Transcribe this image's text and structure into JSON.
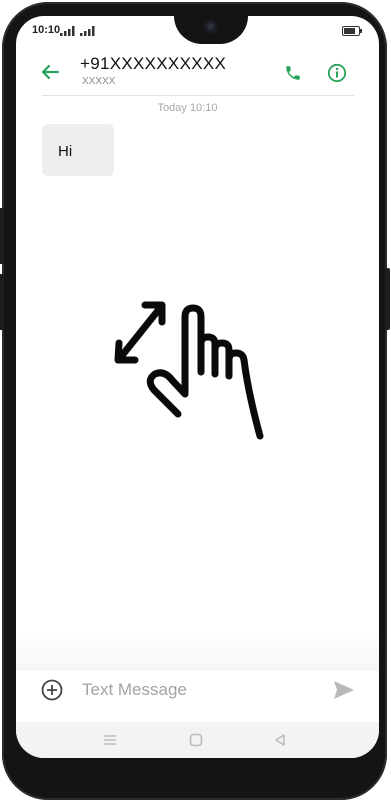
{
  "status_bar": {
    "time": "10:10",
    "icons": [
      "signal-1-icon",
      "signal-2-icon",
      "battery-icon"
    ],
    "battery_level": 0.8
  },
  "header": {
    "contact_number": "+91XXXXXXXXXX",
    "contact_subtitle": "XXXXX",
    "back_icon": "arrow-left-icon",
    "call_icon": "phone-icon",
    "info_icon": "info-icon"
  },
  "conversation": {
    "date_stamp": "Today 10:10",
    "messages": [
      {
        "text": "Hi",
        "direction": "incoming"
      }
    ],
    "gesture_icon": "pinch-zoom-hand-icon"
  },
  "composer": {
    "add_icon": "add-circle-icon",
    "placeholder": "Text Message",
    "value": "",
    "send_icon": "send-icon"
  },
  "nav_bar": {
    "buttons": [
      "menu-icon",
      "home-icon",
      "back-triangle-icon"
    ]
  },
  "colors": {
    "accent": "#27a35a",
    "bubble": "#eeeeee",
    "frame": "#141414"
  }
}
